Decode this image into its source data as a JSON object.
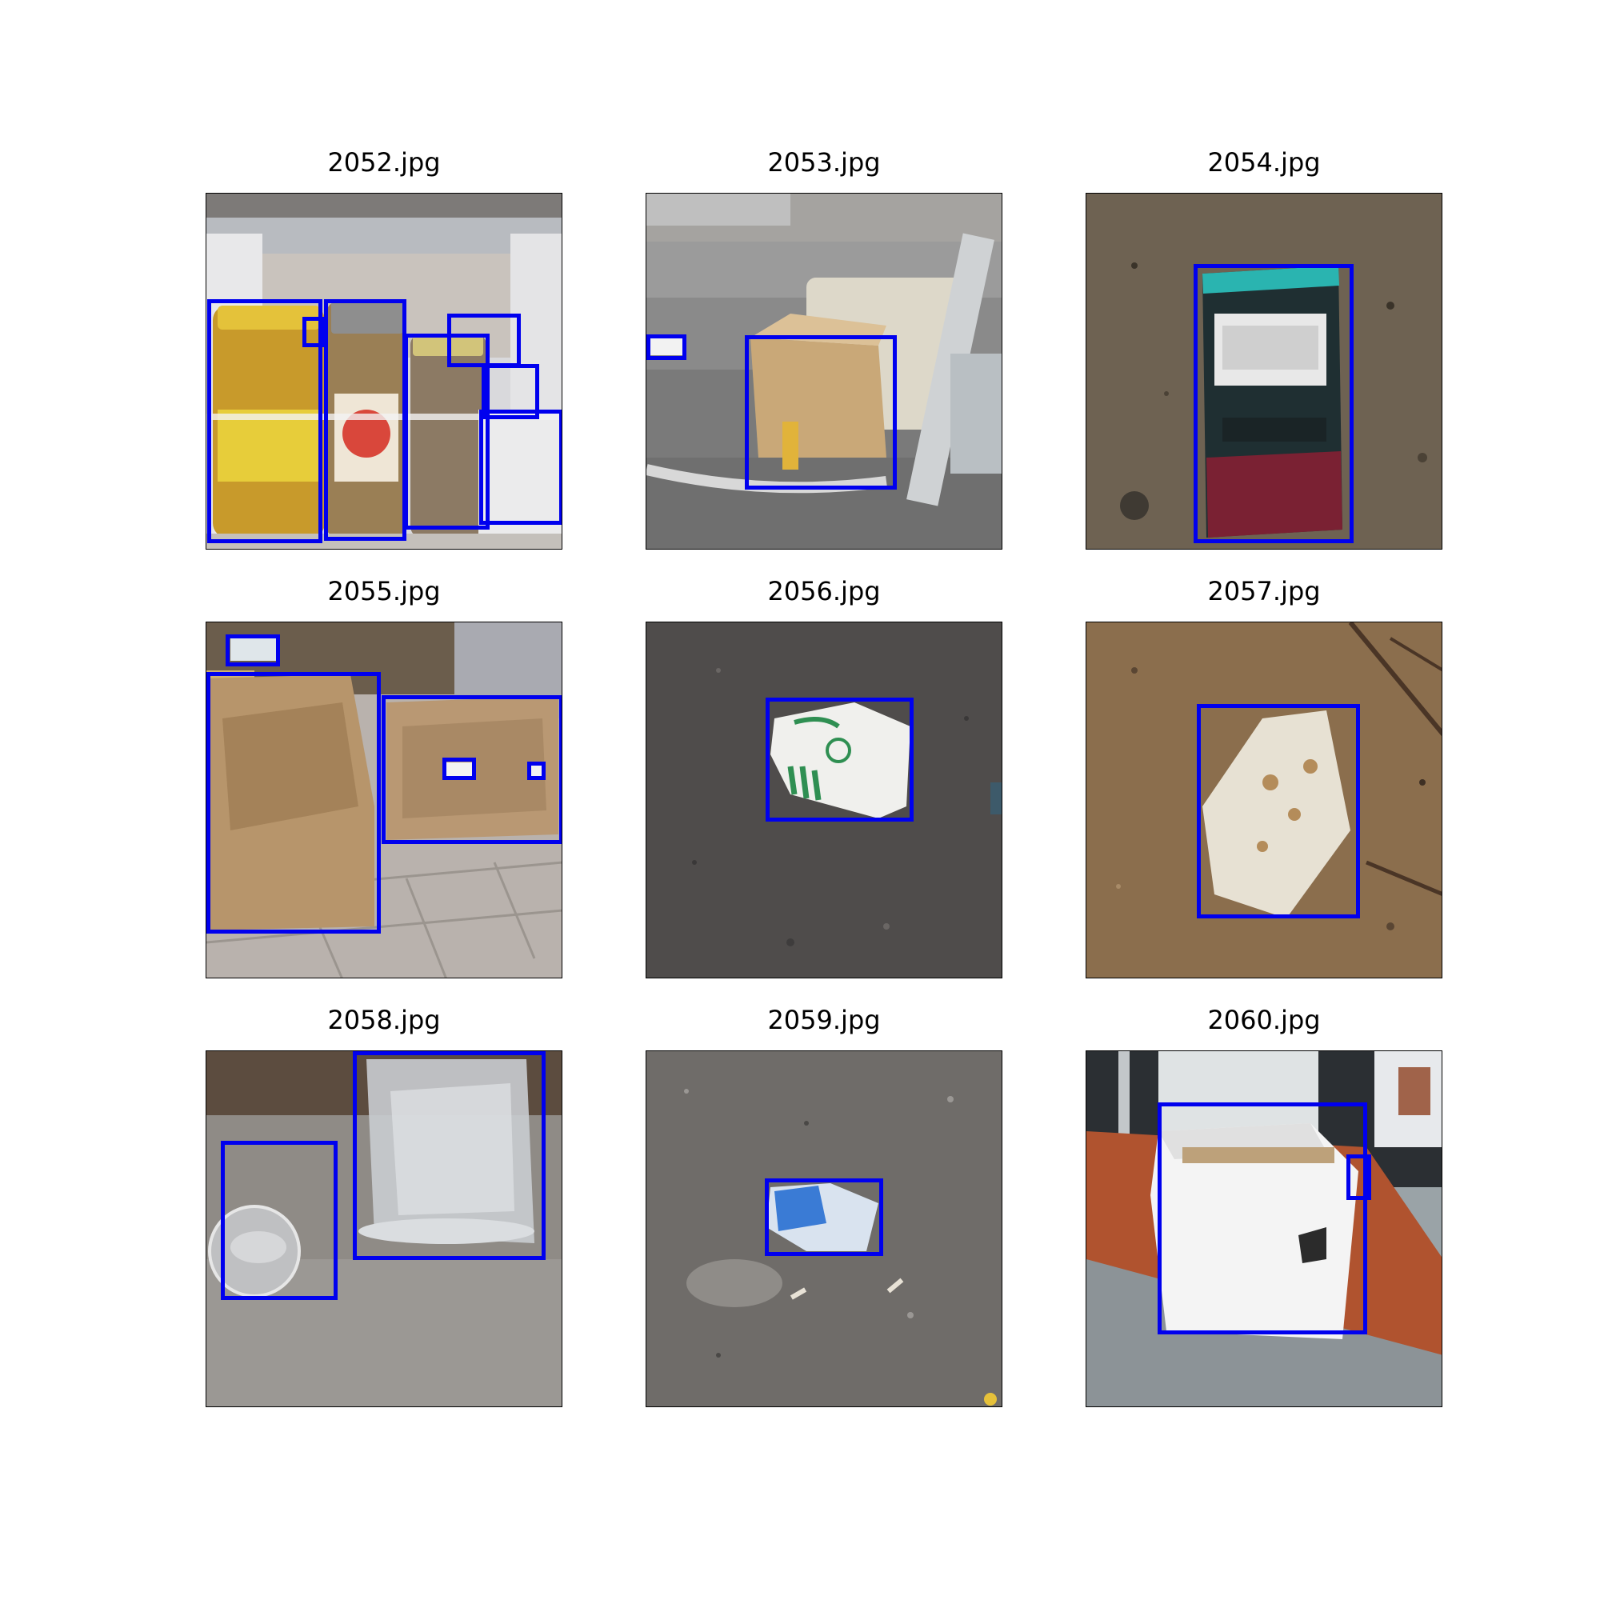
{
  "panels": [
    {
      "title": "2052.jpg"
    },
    {
      "title": "2053.jpg"
    },
    {
      "title": "2054.jpg"
    },
    {
      "title": "2055.jpg"
    },
    {
      "title": "2056.jpg"
    },
    {
      "title": "2057.jpg"
    },
    {
      "title": "2058.jpg"
    },
    {
      "title": "2059.jpg"
    },
    {
      "title": "2060.jpg"
    }
  ],
  "colors": {
    "box_stroke": "#0000ee",
    "axes_frame": "#000000",
    "background": "#ffffff"
  }
}
